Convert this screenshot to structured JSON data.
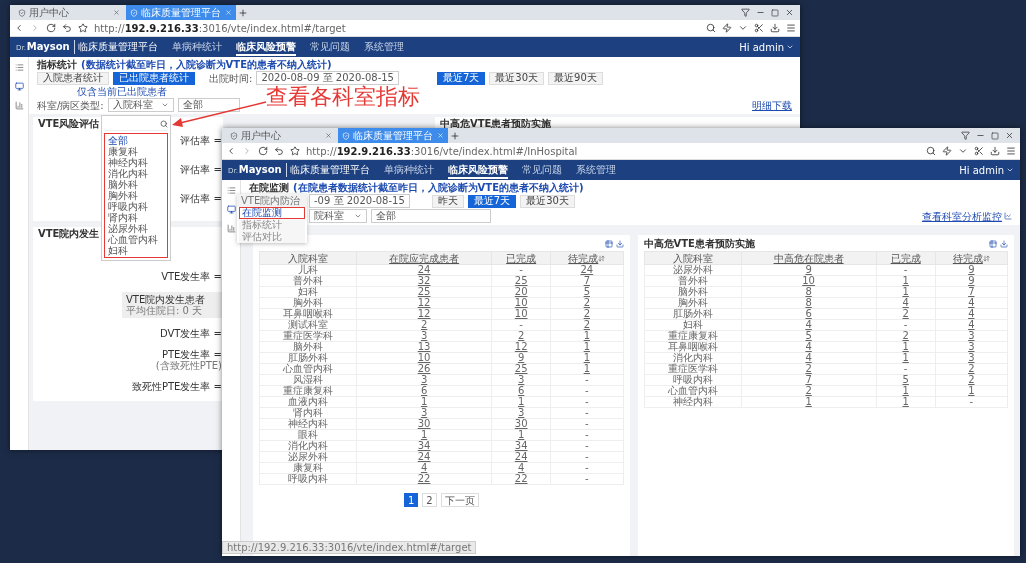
{
  "annotation": {
    "text": "查看各科室指标"
  },
  "back_window": {
    "tabs": [
      {
        "label": "用户中心",
        "selected": false
      },
      {
        "label": "临床质量管理平台",
        "selected": true
      }
    ],
    "url": {
      "prefix": "http://",
      "host": "192.9.216.33",
      "path": ":3016/vte/index.html#/target"
    },
    "brand": {
      "logo": "Dr.",
      "name": "Mayson",
      "title": "临床质量管理平台"
    },
    "nav": [
      {
        "label": "单病种统计",
        "selected": false
      },
      {
        "label": "临床风险预警",
        "selected": true
      },
      {
        "label": "常见问题",
        "selected": false
      },
      {
        "label": "系统管理",
        "selected": false
      }
    ],
    "user": "Hi admin",
    "page_title": "指标统计",
    "page_note": "(数据统计截至昨日，入院诊断为VTE的患者不纳入统计)",
    "mode_buttons": [
      {
        "label": "入院患者统计",
        "selected": false
      },
      {
        "label": "已出院患者统计",
        "selected": true
      }
    ],
    "mode_hint": "仅含当前已出院患者",
    "date_label": "出院时间:",
    "date_range": "2020-08-09 至 2020-08-15",
    "ranges": [
      {
        "label": "最近7天",
        "selected": true
      },
      {
        "label": "最近30天",
        "selected": false
      },
      {
        "label": "最近90天",
        "selected": false
      }
    ],
    "filter_label": "科室/病区类型:",
    "filter_type": "入院科室",
    "filter_value": "全部",
    "download": "明细下载",
    "dropdown": [
      {
        "label": "全部",
        "selected": true
      },
      {
        "label": "康复科",
        "selected": false
      },
      {
        "label": "神经内科",
        "selected": false
      },
      {
        "label": "消化内科",
        "selected": false
      },
      {
        "label": "脑外科",
        "selected": false
      },
      {
        "label": "胸外科",
        "selected": false
      },
      {
        "label": "呼吸内科",
        "selected": false
      },
      {
        "label": "肾内科",
        "selected": false
      },
      {
        "label": "泌尿外科",
        "selected": false
      },
      {
        "label": "心血管内科",
        "selected": false
      },
      {
        "label": "妇科",
        "selected": false
      }
    ],
    "risk_card": {
      "title": "VTE风险评估",
      "rows": [
        "评估率 =",
        "评估率 =",
        "评估率 ="
      ]
    },
    "prevention_card": {
      "title": "中高危VTE患者预防实施"
    },
    "incidence_card": {
      "title": "VTE院内发生",
      "rows": [
        {
          "kind": "rate",
          "label": "VTE发生率 ="
        },
        {
          "kind": "summary",
          "label": "VTE院内发生患者",
          "note": "平均住院日: 0 天"
        },
        {
          "kind": "rate",
          "label": "DVT发生率 ="
        },
        {
          "kind": "rate",
          "label": "PTE发生率 =",
          "note": "(含致死性PTE)"
        },
        {
          "kind": "rate",
          "label": "致死性PTE发生率 ="
        }
      ]
    }
  },
  "front_window": {
    "tabs": [
      {
        "label": "用户中心",
        "selected": false
      },
      {
        "label": "临床质量管理平台",
        "selected": true
      }
    ],
    "url": {
      "prefix": "http://",
      "host": "192.9.216.33",
      "path": ":3016/vte/index.html#/InHospital"
    },
    "brand": {
      "logo": "Dr.",
      "name": "Mayson",
      "title": "临床质量管理平台"
    },
    "nav": [
      {
        "label": "单病种统计",
        "selected": false
      },
      {
        "label": "临床风险预警",
        "selected": true
      },
      {
        "label": "常见问题",
        "selected": false
      },
      {
        "label": "系统管理",
        "selected": false
      }
    ],
    "user": "Hi admin",
    "page_title": "在院监测",
    "page_note": "(在院患者数据统计截至昨日，入院诊断为VTE的患者不纳入统计)",
    "date_range": "-09 至 2020-08-15",
    "ranges": [
      {
        "label": "昨天",
        "selected": false
      },
      {
        "label": "最近7天",
        "selected": true
      },
      {
        "label": "最近30天",
        "selected": false
      }
    ],
    "filter_type": "院科室",
    "filter_value": "全部",
    "analysis_link": "查看科室分析监控",
    "menu": {
      "header": "VTE院内防治",
      "items": [
        {
          "label": "在院监测",
          "selected": true
        },
        {
          "label": "指标统计",
          "selected": false
        },
        {
          "label": "评估对比",
          "selected": false
        }
      ]
    },
    "left_table": {
      "columns": [
        "入院科室",
        "在院应完成患者",
        "已完成",
        "待完成"
      ],
      "rows": [
        [
          "儿科",
          "24",
          "-",
          "24"
        ],
        [
          "普外科",
          "32",
          "25",
          "7"
        ],
        [
          "妇科",
          "25",
          "20",
          "5"
        ],
        [
          "胸外科",
          "12",
          "10",
          "2"
        ],
        [
          "耳鼻咽喉科",
          "12",
          "10",
          "2"
        ],
        [
          "测试科室",
          "2",
          "-",
          "2"
        ],
        [
          "重症医学科",
          "3",
          "2",
          "1"
        ],
        [
          "脑外科",
          "13",
          "12",
          "1"
        ],
        [
          "肛肠外科",
          "10",
          "9",
          "1"
        ],
        [
          "心血管内科",
          "26",
          "25",
          "1"
        ],
        [
          "风湿科",
          "3",
          "3",
          "-"
        ],
        [
          "重症康复科",
          "6",
          "6",
          "-"
        ],
        [
          "血液内科",
          "1",
          "1",
          "-"
        ],
        [
          "肾内科",
          "3",
          "3",
          "-"
        ],
        [
          "神经内科",
          "30",
          "30",
          "-"
        ],
        [
          "眼科",
          "1",
          "1",
          "-"
        ],
        [
          "消化内科",
          "34",
          "34",
          "-"
        ],
        [
          "泌尿外科",
          "24",
          "24",
          "-"
        ],
        [
          "康复科",
          "4",
          "4",
          "-"
        ],
        [
          "呼吸内科",
          "22",
          "22",
          "-"
        ]
      ]
    },
    "pages": [
      {
        "label": "1",
        "selected": true
      },
      {
        "label": "2",
        "selected": false
      },
      {
        "label": "下一页",
        "selected": false
      }
    ],
    "right_table": {
      "title": "中高危VTE患者预防实施",
      "columns": [
        "入院科室",
        "中高危在院患者",
        "已完成",
        "待完成"
      ],
      "rows": [
        [
          "泌尿外科",
          "9",
          "-",
          "9"
        ],
        [
          "普外科",
          "10",
          "1",
          "9"
        ],
        [
          "脑外科",
          "8",
          "1",
          "7"
        ],
        [
          "胸外科",
          "8",
          "4",
          "4"
        ],
        [
          "肛肠外科",
          "6",
          "2",
          "4"
        ],
        [
          "妇科",
          "4",
          "-",
          "4"
        ],
        [
          "重症康复科",
          "5",
          "2",
          "3"
        ],
        [
          "耳鼻咽喉科",
          "4",
          "1",
          "3"
        ],
        [
          "消化内科",
          "4",
          "1",
          "3"
        ],
        [
          "重症医学科",
          "2",
          "-",
          "2"
        ],
        [
          "呼吸内科",
          "7",
          "5",
          "2"
        ],
        [
          "心血管内科",
          "2",
          "1",
          "1"
        ],
        [
          "神经内科",
          "1",
          "1",
          "-"
        ]
      ]
    },
    "status_url": "http://192.9.216.33:3016/vte/index.html#/target"
  }
}
